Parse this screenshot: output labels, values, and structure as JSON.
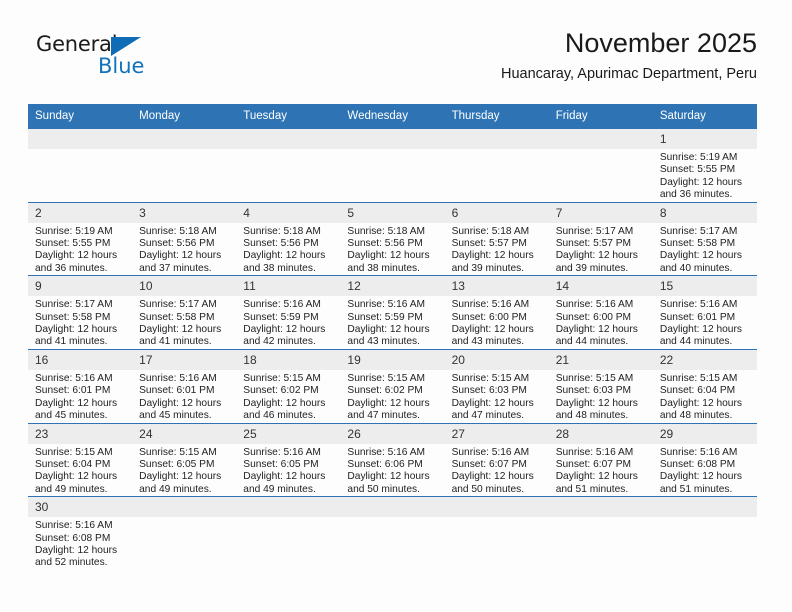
{
  "brand": {
    "name_part1": "General",
    "name_part2": "Blue",
    "triangle_color": "#0f6cb5",
    "blue_text_color": "#1273bd"
  },
  "header": {
    "title": "November 2025",
    "subtitle": "Huancaray, Apurimac Department, Peru"
  },
  "theme": {
    "header_blue": "#2e74b5",
    "daynum_background": "#ededed",
    "page_background": "#fdfdfd"
  },
  "weekday_headers": [
    "Sunday",
    "Monday",
    "Tuesday",
    "Wednesday",
    "Thursday",
    "Friday",
    "Saturday"
  ],
  "labels": {
    "sunrise_prefix": "Sunrise:",
    "sunset_prefix": "Sunset:",
    "daylight_prefix": "Daylight:"
  },
  "weeks": [
    [
      {
        "empty": true
      },
      {
        "empty": true
      },
      {
        "empty": true
      },
      {
        "empty": true
      },
      {
        "empty": true
      },
      {
        "empty": true
      },
      {
        "day": "1",
        "sunrise": "Sunrise: 5:19 AM",
        "sunset": "Sunset: 5:55 PM",
        "daylight_line1": "Daylight: 12 hours",
        "daylight_line2": "and 36 minutes."
      }
    ],
    [
      {
        "day": "2",
        "sunrise": "Sunrise: 5:19 AM",
        "sunset": "Sunset: 5:55 PM",
        "daylight_line1": "Daylight: 12 hours",
        "daylight_line2": "and 36 minutes."
      },
      {
        "day": "3",
        "sunrise": "Sunrise: 5:18 AM",
        "sunset": "Sunset: 5:56 PM",
        "daylight_line1": "Daylight: 12 hours",
        "daylight_line2": "and 37 minutes."
      },
      {
        "day": "4",
        "sunrise": "Sunrise: 5:18 AM",
        "sunset": "Sunset: 5:56 PM",
        "daylight_line1": "Daylight: 12 hours",
        "daylight_line2": "and 38 minutes."
      },
      {
        "day": "5",
        "sunrise": "Sunrise: 5:18 AM",
        "sunset": "Sunset: 5:56 PM",
        "daylight_line1": "Daylight: 12 hours",
        "daylight_line2": "and 38 minutes."
      },
      {
        "day": "6",
        "sunrise": "Sunrise: 5:18 AM",
        "sunset": "Sunset: 5:57 PM",
        "daylight_line1": "Daylight: 12 hours",
        "daylight_line2": "and 39 minutes."
      },
      {
        "day": "7",
        "sunrise": "Sunrise: 5:17 AM",
        "sunset": "Sunset: 5:57 PM",
        "daylight_line1": "Daylight: 12 hours",
        "daylight_line2": "and 39 minutes."
      },
      {
        "day": "8",
        "sunrise": "Sunrise: 5:17 AM",
        "sunset": "Sunset: 5:58 PM",
        "daylight_line1": "Daylight: 12 hours",
        "daylight_line2": "and 40 minutes."
      }
    ],
    [
      {
        "day": "9",
        "sunrise": "Sunrise: 5:17 AM",
        "sunset": "Sunset: 5:58 PM",
        "daylight_line1": "Daylight: 12 hours",
        "daylight_line2": "and 41 minutes."
      },
      {
        "day": "10",
        "sunrise": "Sunrise: 5:17 AM",
        "sunset": "Sunset: 5:58 PM",
        "daylight_line1": "Daylight: 12 hours",
        "daylight_line2": "and 41 minutes."
      },
      {
        "day": "11",
        "sunrise": "Sunrise: 5:16 AM",
        "sunset": "Sunset: 5:59 PM",
        "daylight_line1": "Daylight: 12 hours",
        "daylight_line2": "and 42 minutes."
      },
      {
        "day": "12",
        "sunrise": "Sunrise: 5:16 AM",
        "sunset": "Sunset: 5:59 PM",
        "daylight_line1": "Daylight: 12 hours",
        "daylight_line2": "and 43 minutes."
      },
      {
        "day": "13",
        "sunrise": "Sunrise: 5:16 AM",
        "sunset": "Sunset: 6:00 PM",
        "daylight_line1": "Daylight: 12 hours",
        "daylight_line2": "and 43 minutes."
      },
      {
        "day": "14",
        "sunrise": "Sunrise: 5:16 AM",
        "sunset": "Sunset: 6:00 PM",
        "daylight_line1": "Daylight: 12 hours",
        "daylight_line2": "and 44 minutes."
      },
      {
        "day": "15",
        "sunrise": "Sunrise: 5:16 AM",
        "sunset": "Sunset: 6:01 PM",
        "daylight_line1": "Daylight: 12 hours",
        "daylight_line2": "and 44 minutes."
      }
    ],
    [
      {
        "day": "16",
        "sunrise": "Sunrise: 5:16 AM",
        "sunset": "Sunset: 6:01 PM",
        "daylight_line1": "Daylight: 12 hours",
        "daylight_line2": "and 45 minutes."
      },
      {
        "day": "17",
        "sunrise": "Sunrise: 5:16 AM",
        "sunset": "Sunset: 6:01 PM",
        "daylight_line1": "Daylight: 12 hours",
        "daylight_line2": "and 45 minutes."
      },
      {
        "day": "18",
        "sunrise": "Sunrise: 5:15 AM",
        "sunset": "Sunset: 6:02 PM",
        "daylight_line1": "Daylight: 12 hours",
        "daylight_line2": "and 46 minutes."
      },
      {
        "day": "19",
        "sunrise": "Sunrise: 5:15 AM",
        "sunset": "Sunset: 6:02 PM",
        "daylight_line1": "Daylight: 12 hours",
        "daylight_line2": "and 47 minutes."
      },
      {
        "day": "20",
        "sunrise": "Sunrise: 5:15 AM",
        "sunset": "Sunset: 6:03 PM",
        "daylight_line1": "Daylight: 12 hours",
        "daylight_line2": "and 47 minutes."
      },
      {
        "day": "21",
        "sunrise": "Sunrise: 5:15 AM",
        "sunset": "Sunset: 6:03 PM",
        "daylight_line1": "Daylight: 12 hours",
        "daylight_line2": "and 48 minutes."
      },
      {
        "day": "22",
        "sunrise": "Sunrise: 5:15 AM",
        "sunset": "Sunset: 6:04 PM",
        "daylight_line1": "Daylight: 12 hours",
        "daylight_line2": "and 48 minutes."
      }
    ],
    [
      {
        "day": "23",
        "sunrise": "Sunrise: 5:15 AM",
        "sunset": "Sunset: 6:04 PM",
        "daylight_line1": "Daylight: 12 hours",
        "daylight_line2": "and 49 minutes."
      },
      {
        "day": "24",
        "sunrise": "Sunrise: 5:15 AM",
        "sunset": "Sunset: 6:05 PM",
        "daylight_line1": "Daylight: 12 hours",
        "daylight_line2": "and 49 minutes."
      },
      {
        "day": "25",
        "sunrise": "Sunrise: 5:16 AM",
        "sunset": "Sunset: 6:05 PM",
        "daylight_line1": "Daylight: 12 hours",
        "daylight_line2": "and 49 minutes."
      },
      {
        "day": "26",
        "sunrise": "Sunrise: 5:16 AM",
        "sunset": "Sunset: 6:06 PM",
        "daylight_line1": "Daylight: 12 hours",
        "daylight_line2": "and 50 minutes."
      },
      {
        "day": "27",
        "sunrise": "Sunrise: 5:16 AM",
        "sunset": "Sunset: 6:07 PM",
        "daylight_line1": "Daylight: 12 hours",
        "daylight_line2": "and 50 minutes."
      },
      {
        "day": "28",
        "sunrise": "Sunrise: 5:16 AM",
        "sunset": "Sunset: 6:07 PM",
        "daylight_line1": "Daylight: 12 hours",
        "daylight_line2": "and 51 minutes."
      },
      {
        "day": "29",
        "sunrise": "Sunrise: 5:16 AM",
        "sunset": "Sunset: 6:08 PM",
        "daylight_line1": "Daylight: 12 hours",
        "daylight_line2": "and 51 minutes."
      }
    ],
    [
      {
        "day": "30",
        "sunrise": "Sunrise: 5:16 AM",
        "sunset": "Sunset: 6:08 PM",
        "daylight_line1": "Daylight: 12 hours",
        "daylight_line2": "and 52 minutes."
      },
      {
        "empty": true
      },
      {
        "empty": true
      },
      {
        "empty": true
      },
      {
        "empty": true
      },
      {
        "empty": true
      },
      {
        "empty": true
      }
    ]
  ]
}
